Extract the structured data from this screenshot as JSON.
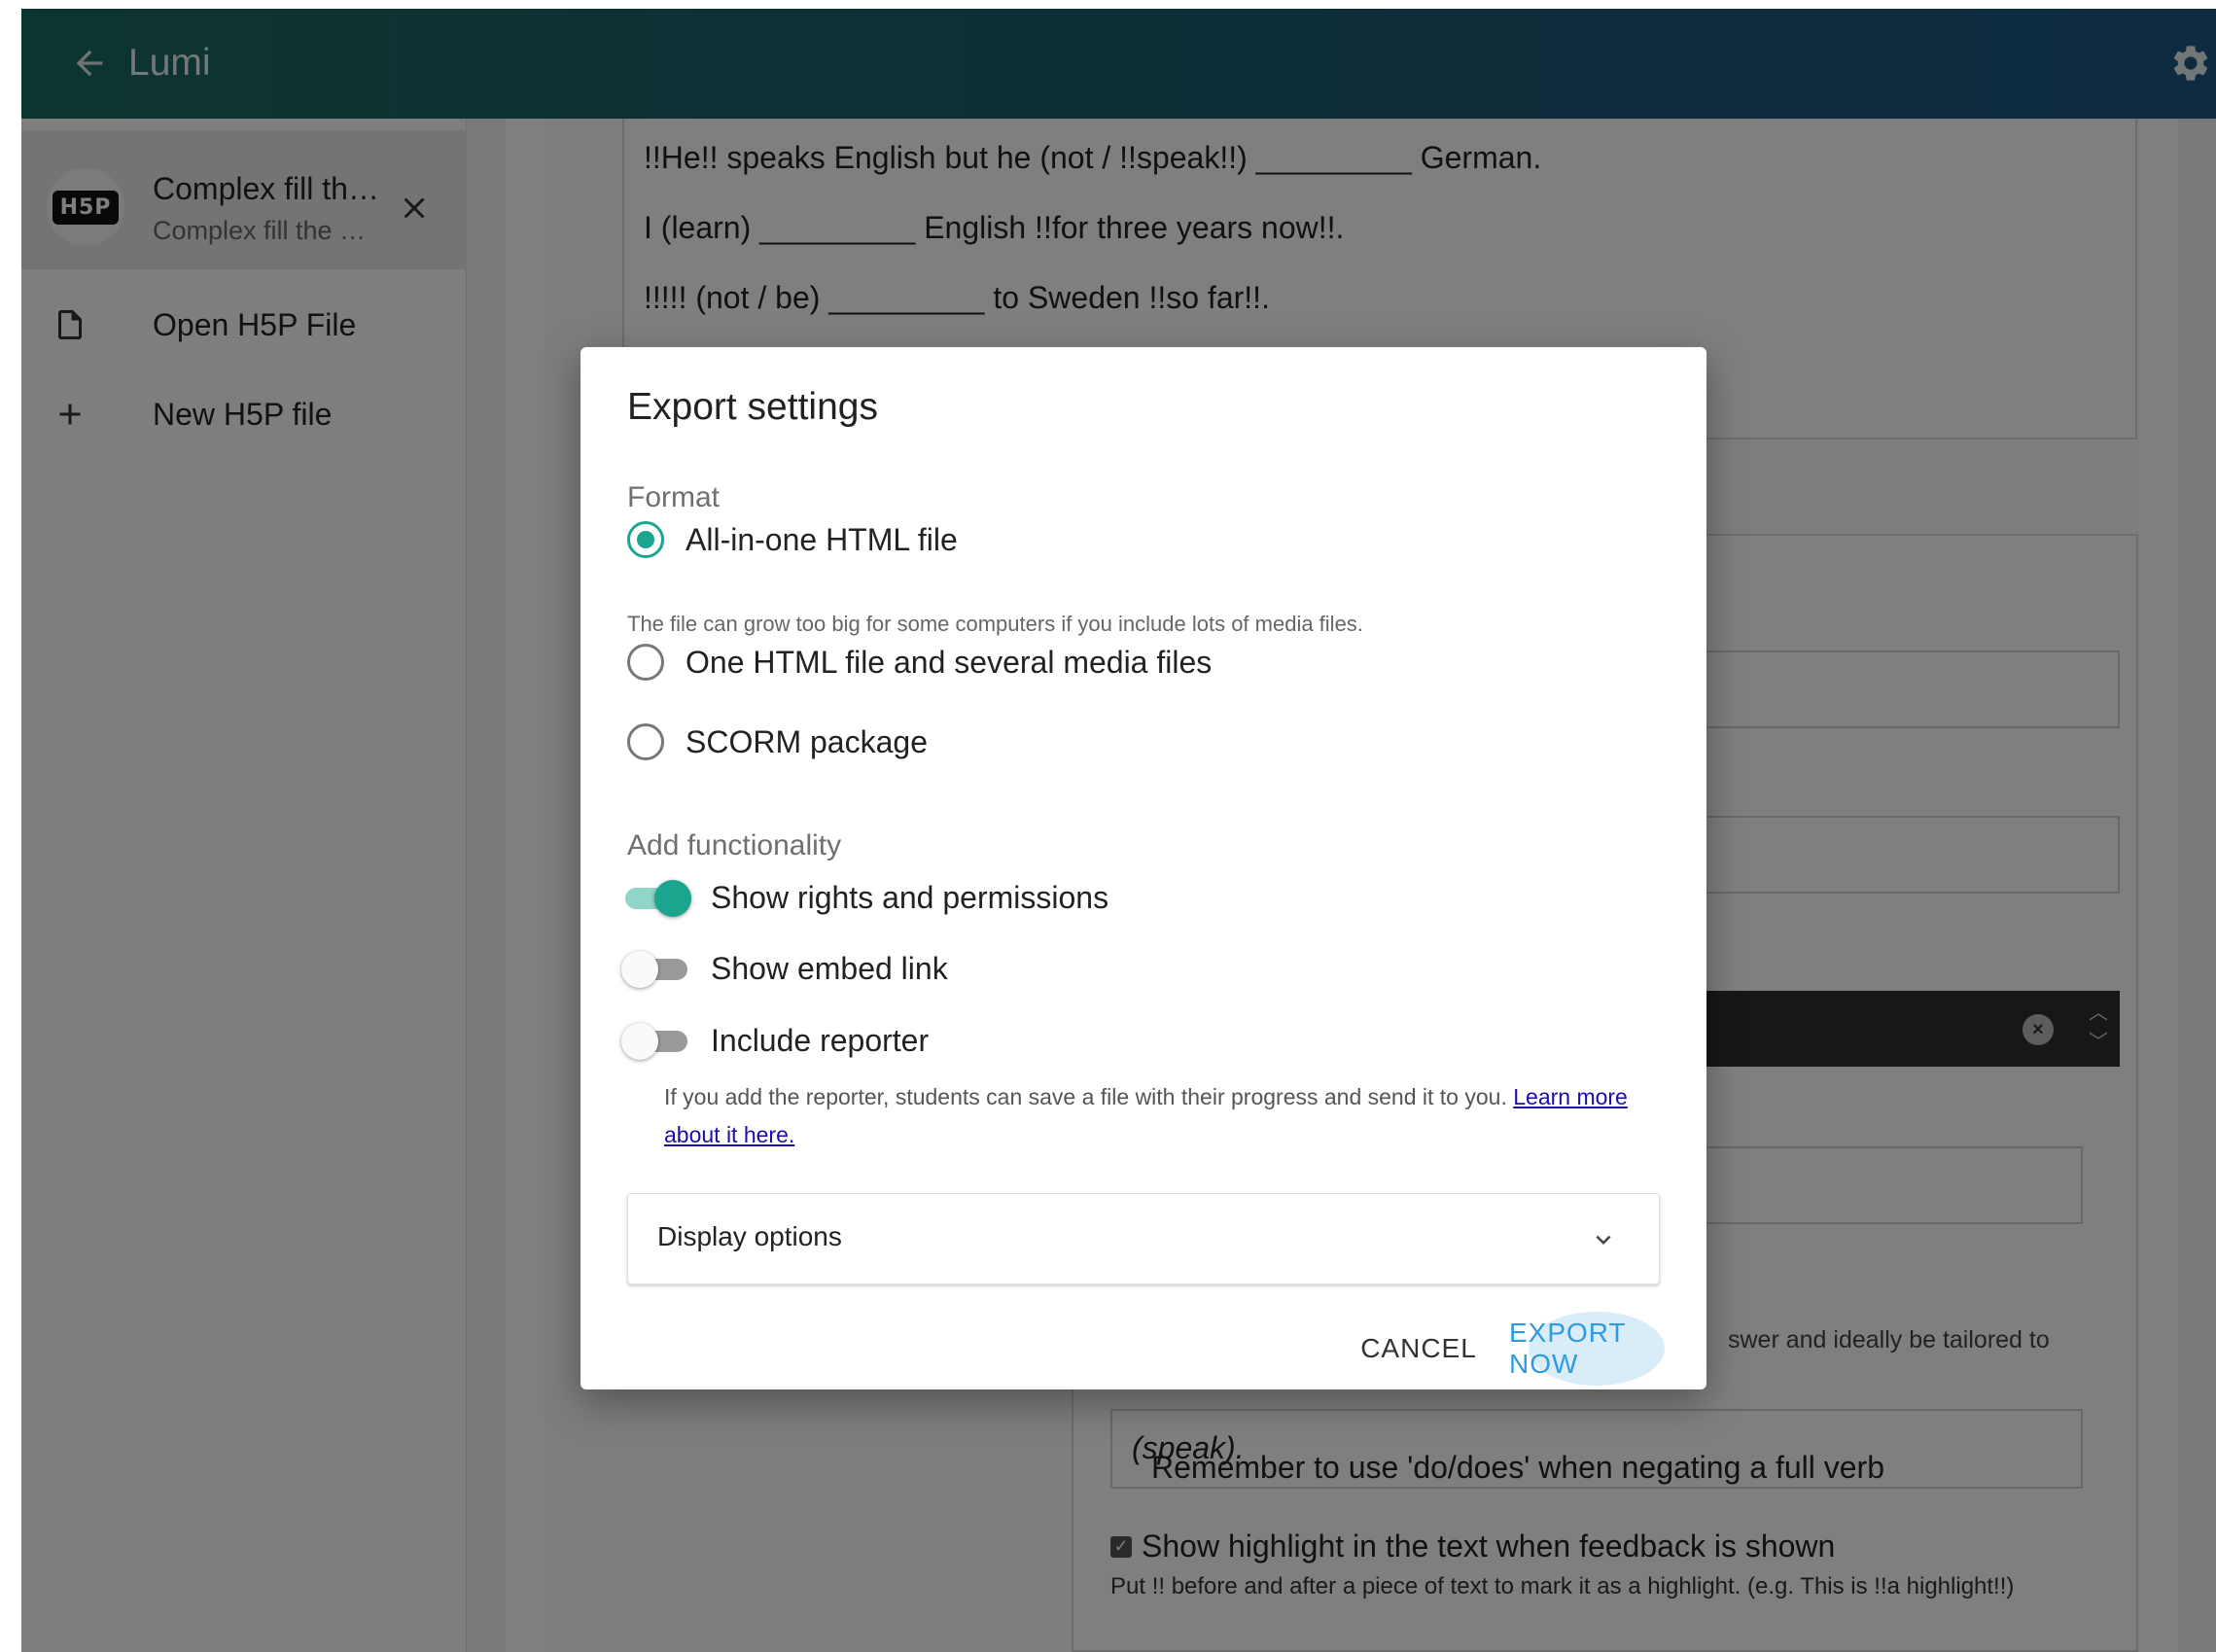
{
  "app": {
    "title": "Lumi"
  },
  "sidebar": {
    "open_tab": {
      "title": "Complex fill th…",
      "subtitle": "Complex fill the …",
      "badge": "H5P"
    },
    "items": [
      {
        "label": "Open H5P File",
        "icon": "file-icon"
      },
      {
        "label": "New H5P file",
        "icon": "plus-icon"
      }
    ]
  },
  "editor": {
    "text_lines": [
      "!!He!! speaks English but he (not / !!speak!!) _________ German.",
      "I (learn) _________ English !!for three years now!!.",
      "!!!!! (not / be) _________ to Sweden !!so far!!."
    ],
    "feedback_hint_fragment": "swer and ideally be tailored to",
    "feedback_text_plain": "Remember to use 'do/does' when negating a full verb ",
    "feedback_text_italic": "(speak).",
    "highlight_checkbox_label": "Show highlight in the text when feedback is shown",
    "highlight_help": "Put !! before and after a piece of text to mark it as a highlight. (e.g. This is !!a highlight!!)"
  },
  "dialog": {
    "title": "Export settings",
    "format_label": "Format",
    "formats": [
      {
        "label": "All-in-one HTML file",
        "selected": true
      },
      {
        "label": "One HTML file and several media files",
        "selected": false
      },
      {
        "label": "SCORM package",
        "selected": false
      }
    ],
    "format_hint": "The file can grow too big for some computers if you include lots of media files.",
    "functionality_label": "Add functionality",
    "toggles": [
      {
        "label": "Show rights and permissions",
        "on": true
      },
      {
        "label": "Show embed link",
        "on": false
      },
      {
        "label": "Include reporter",
        "on": false
      }
    ],
    "reporter_help": "If you add the reporter, students can save a file with their progress and send it to you.",
    "reporter_link": "Learn more about it here.",
    "display_options_label": "Display options",
    "cancel_label": "CANCEL",
    "export_label": "EXPORT NOW"
  },
  "colors": {
    "accent": "#1aa58e",
    "primary_button": "#2e9be0",
    "appbar_start": "#1a6b5e",
    "appbar_end": "#1e5782"
  }
}
